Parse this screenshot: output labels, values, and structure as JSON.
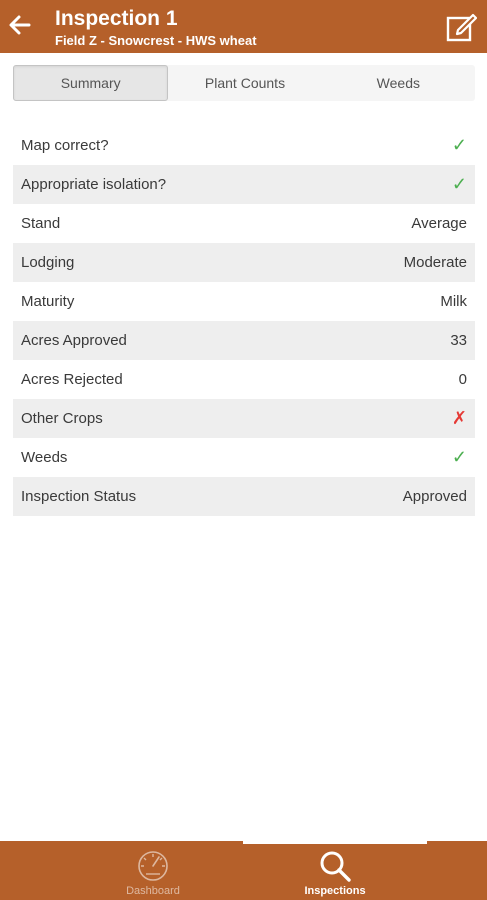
{
  "header": {
    "title": "Inspection 1",
    "subtitle": "Field Z - Snowcrest - HWS wheat",
    "back_icon": "arrow-left-icon",
    "edit_icon": "edit-icon"
  },
  "tabs": [
    {
      "label": "Summary",
      "active": true
    },
    {
      "label": "Plant Counts",
      "active": false
    },
    {
      "label": "Weeds",
      "active": false
    }
  ],
  "summary": [
    {
      "label": "Map correct?",
      "value": "✓",
      "kind": "check"
    },
    {
      "label": "Appropriate isolation?",
      "value": "✓",
      "kind": "check"
    },
    {
      "label": "Stand",
      "value": "Average",
      "kind": "text"
    },
    {
      "label": "Lodging",
      "value": "Moderate",
      "kind": "text"
    },
    {
      "label": "Maturity",
      "value": "Milk",
      "kind": "text"
    },
    {
      "label": "Acres Approved",
      "value": "33",
      "kind": "text"
    },
    {
      "label": "Acres Rejected",
      "value": "0",
      "kind": "text"
    },
    {
      "label": "Other Crops",
      "value": "✗",
      "kind": "cross"
    },
    {
      "label": "Weeds",
      "value": "✓",
      "kind": "check"
    },
    {
      "label": "Inspection Status",
      "value": "Approved",
      "kind": "text"
    }
  ],
  "bottom_nav": [
    {
      "label": "Dashboard",
      "icon": "speedometer-icon",
      "active": false
    },
    {
      "label": "Inspections",
      "icon": "search-icon",
      "active": true
    }
  ],
  "colors": {
    "brand": "#b5602a",
    "check": "#4caf50",
    "cross": "#e53935"
  }
}
